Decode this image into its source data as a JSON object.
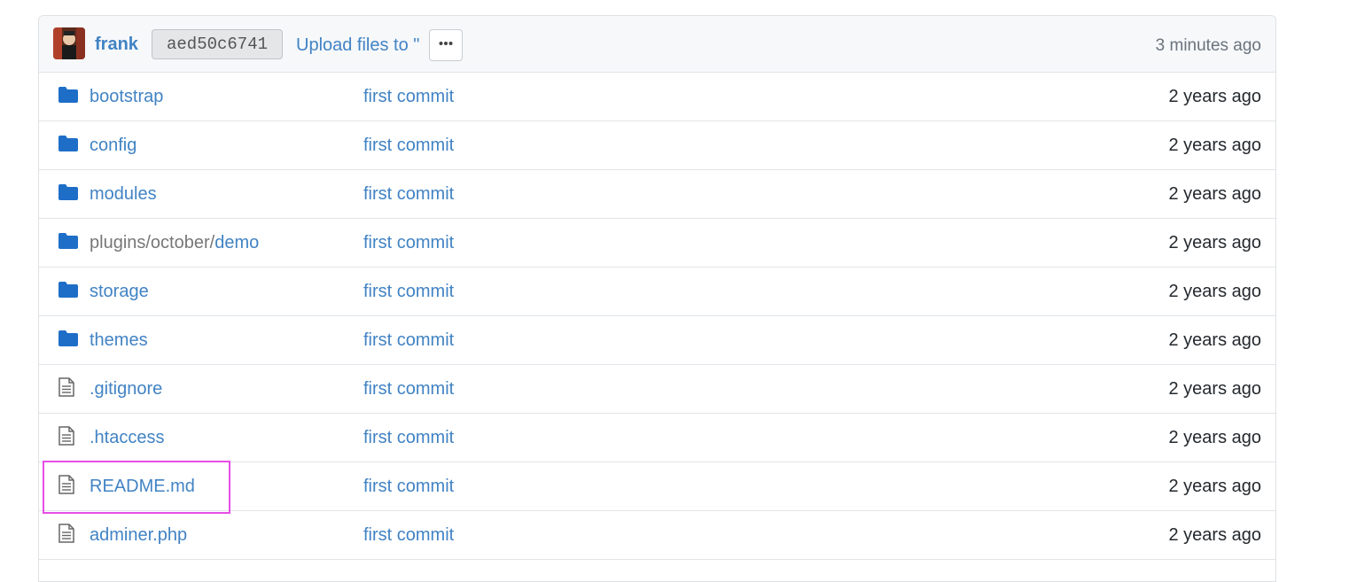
{
  "header": {
    "author": "frank",
    "sha": "aed50c6741",
    "message": "Upload files to \"",
    "ellipsis": "•••",
    "age": "3 minutes ago"
  },
  "rows": [
    {
      "type": "folder",
      "prefix": "",
      "name": "bootstrap",
      "message": "first commit",
      "age": "2 years ago"
    },
    {
      "type": "folder",
      "prefix": "",
      "name": "config",
      "message": "first commit",
      "age": "2 years ago"
    },
    {
      "type": "folder",
      "prefix": "",
      "name": "modules",
      "message": "first commit",
      "age": "2 years ago"
    },
    {
      "type": "folder",
      "prefix": "plugins/october/",
      "name": "demo",
      "message": "first commit",
      "age": "2 years ago"
    },
    {
      "type": "folder",
      "prefix": "",
      "name": "storage",
      "message": "first commit",
      "age": "2 years ago"
    },
    {
      "type": "folder",
      "prefix": "",
      "name": "themes",
      "message": "first commit",
      "age": "2 years ago"
    },
    {
      "type": "file",
      "prefix": "",
      "name": ".gitignore",
      "message": "first commit",
      "age": "2 years ago"
    },
    {
      "type": "file",
      "prefix": "",
      "name": ".htaccess",
      "message": "first commit",
      "age": "2 years ago"
    },
    {
      "type": "file",
      "prefix": "",
      "name": "README.md",
      "message": "first commit",
      "age": "2 years ago"
    },
    {
      "type": "file",
      "prefix": "",
      "name": "adminer.php",
      "message": "first commit",
      "age": "2 years ago"
    }
  ],
  "colors": {
    "link": "#4183c4",
    "folder_icon": "#1e6ec8",
    "highlight": "#e64ee6"
  }
}
